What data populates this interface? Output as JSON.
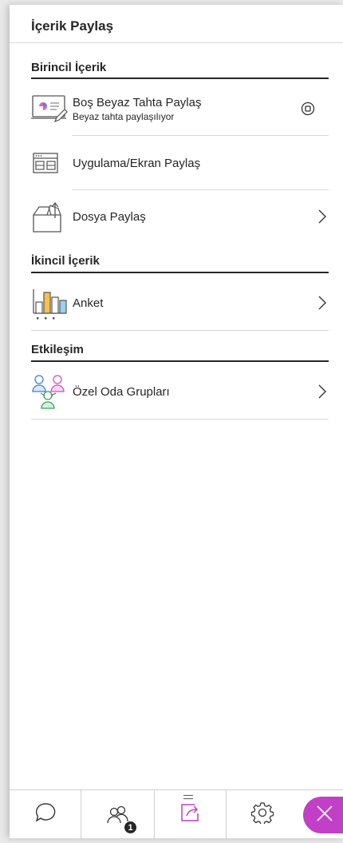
{
  "panel": {
    "title": "İçerik Paylaş"
  },
  "sections": {
    "primary": {
      "title": "Birincil İçerik",
      "items": [
        {
          "label": "Boş Beyaz Tahta Paylaş",
          "sub": "Beyaz tahta paylaşılıyor",
          "icon": "whiteboard-icon",
          "right_icon": "stop-share-icon"
        },
        {
          "label": "Uygulama/Ekran Paylaş",
          "icon": "application-screen-icon"
        },
        {
          "label": "Dosya Paylaş",
          "icon": "file-share-icon",
          "right_icon": "chevron-right-icon"
        }
      ]
    },
    "secondary": {
      "title": "İkincil İçerik",
      "items": [
        {
          "label": "Anket",
          "icon": "poll-icon",
          "right_icon": "chevron-right-icon"
        }
      ]
    },
    "interaction": {
      "title": "Etkileşim",
      "items": [
        {
          "label": "Özel Oda Grupları",
          "icon": "breakout-groups-icon",
          "right_icon": "chevron-right-icon"
        }
      ]
    }
  },
  "bottom_bar": {
    "tabs": [
      {
        "name": "chat",
        "icon": "chat-icon"
      },
      {
        "name": "attendees",
        "icon": "attendees-icon",
        "badge": "1"
      },
      {
        "name": "share-content",
        "icon": "share-content-icon",
        "active": true
      },
      {
        "name": "settings",
        "icon": "gear-icon"
      }
    ],
    "close_icon": "close-icon"
  },
  "colors": {
    "accent": "#c23fc8",
    "text": "#262626",
    "divider": "#d8d8d8"
  }
}
